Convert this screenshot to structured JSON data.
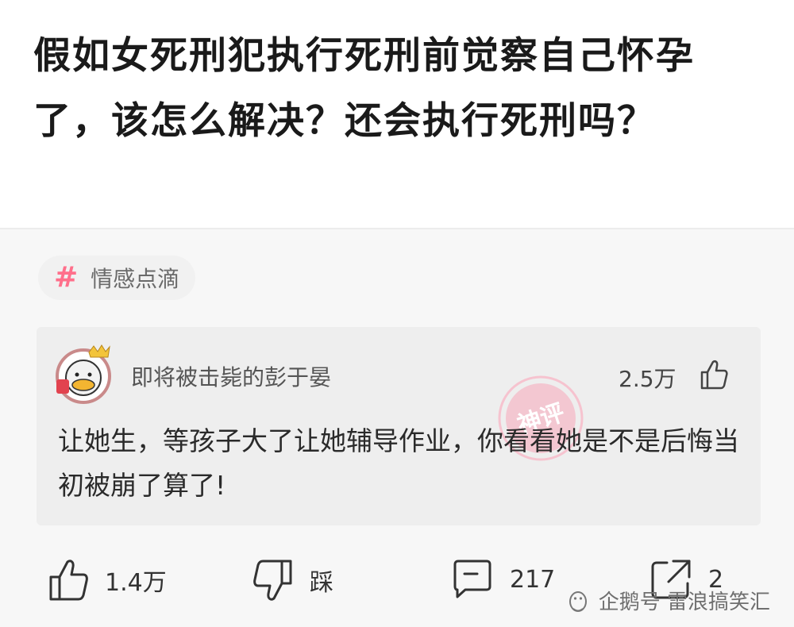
{
  "question": {
    "title": "假如女死刑犯执行死刑前觉察自己怀孕了，该怎么解决？还会执行死刑吗？"
  },
  "topic_tag": {
    "icon": "hash-icon",
    "label": "情感点滴"
  },
  "top_comment": {
    "username": "即将被击毙的彭于晏",
    "likes": "2.5万",
    "badge_text": "神评",
    "text": "让她生，等孩子大了让她辅导作业，你看看她是不是后悔当初被崩了算了!"
  },
  "actions": {
    "like_count": "1.4万",
    "dislike_label": "踩",
    "comment_count": "217",
    "share_count": "2"
  },
  "watermark": {
    "text": "企鹅号 雷浪搞笑汇"
  },
  "colors": {
    "tag_accent": "#ff6f8b",
    "stamp": "#f48aa4"
  }
}
